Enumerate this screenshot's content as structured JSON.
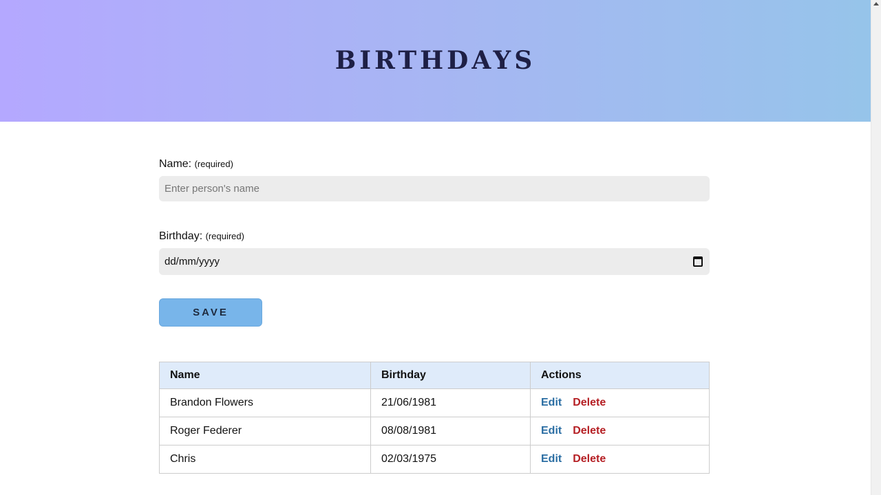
{
  "header": {
    "title": "BIRTHDAYS"
  },
  "form": {
    "name_label": "Name:",
    "name_required": "(required)",
    "name_placeholder": "Enter person's name",
    "name_value": "",
    "birthday_label": "Birthday:",
    "birthday_required": "(required)",
    "birthday_placeholder": "dd/mm/yyyy",
    "save_label": "SAVE"
  },
  "table": {
    "columns": [
      "Name",
      "Birthday",
      "Actions"
    ],
    "rows": [
      {
        "name": "Brandon Flowers",
        "birthday": "21/06/1981",
        "edit": "Edit",
        "delete": "Delete"
      },
      {
        "name": "Roger Federer",
        "birthday": "08/08/1981",
        "edit": "Edit",
        "delete": "Delete"
      },
      {
        "name": "Chris",
        "birthday": "02/03/1975",
        "edit": "Edit",
        "delete": "Delete"
      }
    ]
  },
  "icons": {
    "date_picker": "calendar-icon",
    "scroll_up": "chevron-up-icon"
  },
  "colors": {
    "banner_start": "#b4a8ff",
    "banner_end": "#96c4ea",
    "title": "#1e1f45",
    "save_button": "#78b5ea",
    "table_header": "#dfebfa",
    "edit_link": "#2b6ea3",
    "delete_link": "#b51f24"
  }
}
